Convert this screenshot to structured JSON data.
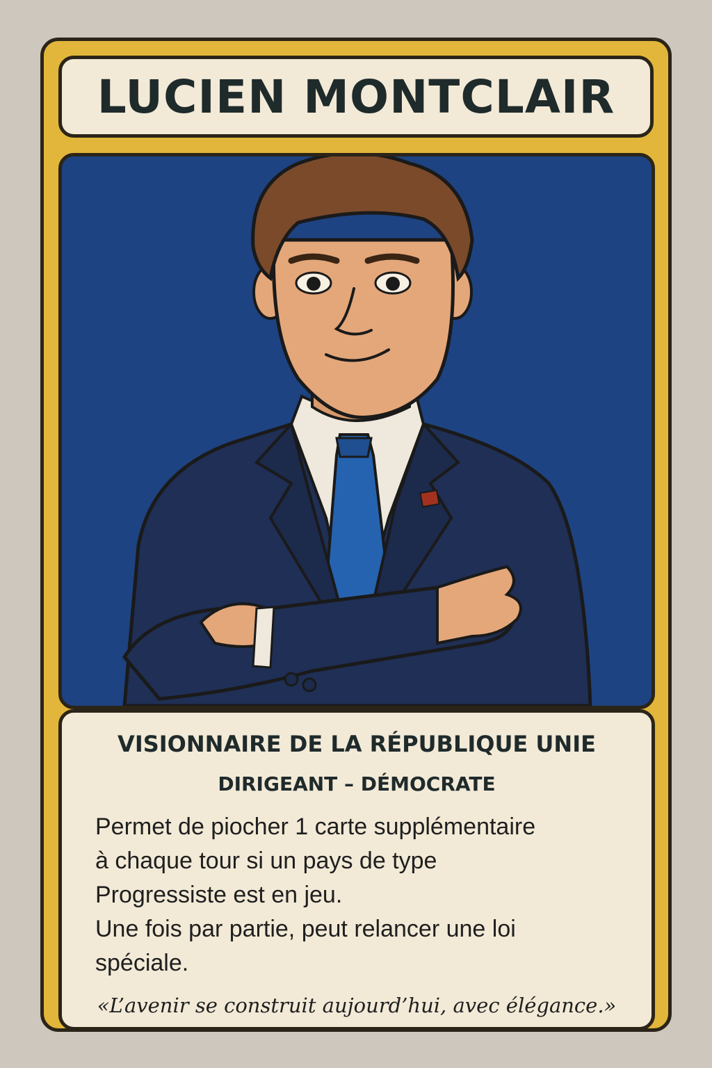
{
  "card": {
    "name": "LUCIEN MONTCLAIR",
    "subtitle": "VISIONNAIRE DE LA RÉPUBLIQUE UNIE",
    "type_line": "DIRIGEANT – DÉMOCRATE",
    "ability_lines": [
      "Permet de piocher 1 carte supplémentaire",
      " à chaque tour si un pays de type",
      " Progressiste est en jeu.",
      " Une fois par partie, peut relancer une loi",
      " spéciale."
    ],
    "quote": "«L’avenir se construit aujourd’hui, avec élégance.»"
  },
  "colors": {
    "frame": "#e2b63a",
    "panel": "#f2ead7",
    "portrait_bg": "#1e4382",
    "suit": "#1f2f55",
    "tie": "#2563b0",
    "outline": "#2b2418"
  },
  "portrait": {
    "icon": "politician-portrait-illustration"
  }
}
